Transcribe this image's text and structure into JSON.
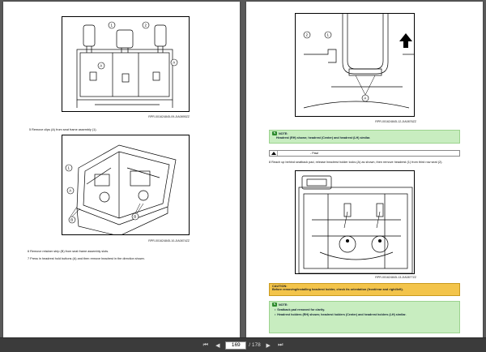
{
  "left_page": {
    "fig1": {
      "id": "RPR-001624845-09-JIA0895ZZ",
      "labels": [
        "1",
        "2",
        "A",
        "A"
      ]
    },
    "step5": "5 Remove clips (A) from seat frame assembly (1).",
    "fig2": {
      "id": "RPR-001624845-10-JIA0874ZZ",
      "labels": [
        "1",
        "A",
        "B",
        "B"
      ]
    },
    "step6": "6 Remove retainer strip (B) from seat frame assembly slots.",
    "step7": "7 Press in headrest hold buttons (A) and then remove headrest in the direction shown."
  },
  "right_page": {
    "fig3": {
      "id": "RPR-001624845-12-JIA0876ZZ",
      "labels": [
        "2",
        "1",
        "A"
      ]
    },
    "note1": {
      "title": "NOTE:",
      "text": "Headrest (RH) shown; headrest (Center) and headrest (LH) similar."
    },
    "legend": {
      "text": "- Pawl"
    },
    "step8": "8 Reach up behind seatback pad, release headrest holder locks (A) as shown, then remove headrest (1) from third row seat (2).",
    "fig4": {
      "id": "RPR-001624845-13-JIA0877ZZ"
    },
    "caution": {
      "title": "CAUTION:",
      "text": "Before removing/installing headrest holder, check its orientation (front/rear and right/left)."
    },
    "note2": {
      "title": "NOTE:",
      "items": [
        "Seatback pad removed for clarity.",
        "Headrest holders (RH) shown; headrest holders (Center) and headrest holders (LH) similar."
      ]
    }
  },
  "toolbar": {
    "current_page": "169",
    "total": "/ 178"
  },
  "colors": {
    "note_bg": "#c8edc0",
    "caution_bg": "#f3c44b",
    "viewer_bg": "#5a5a5a"
  }
}
